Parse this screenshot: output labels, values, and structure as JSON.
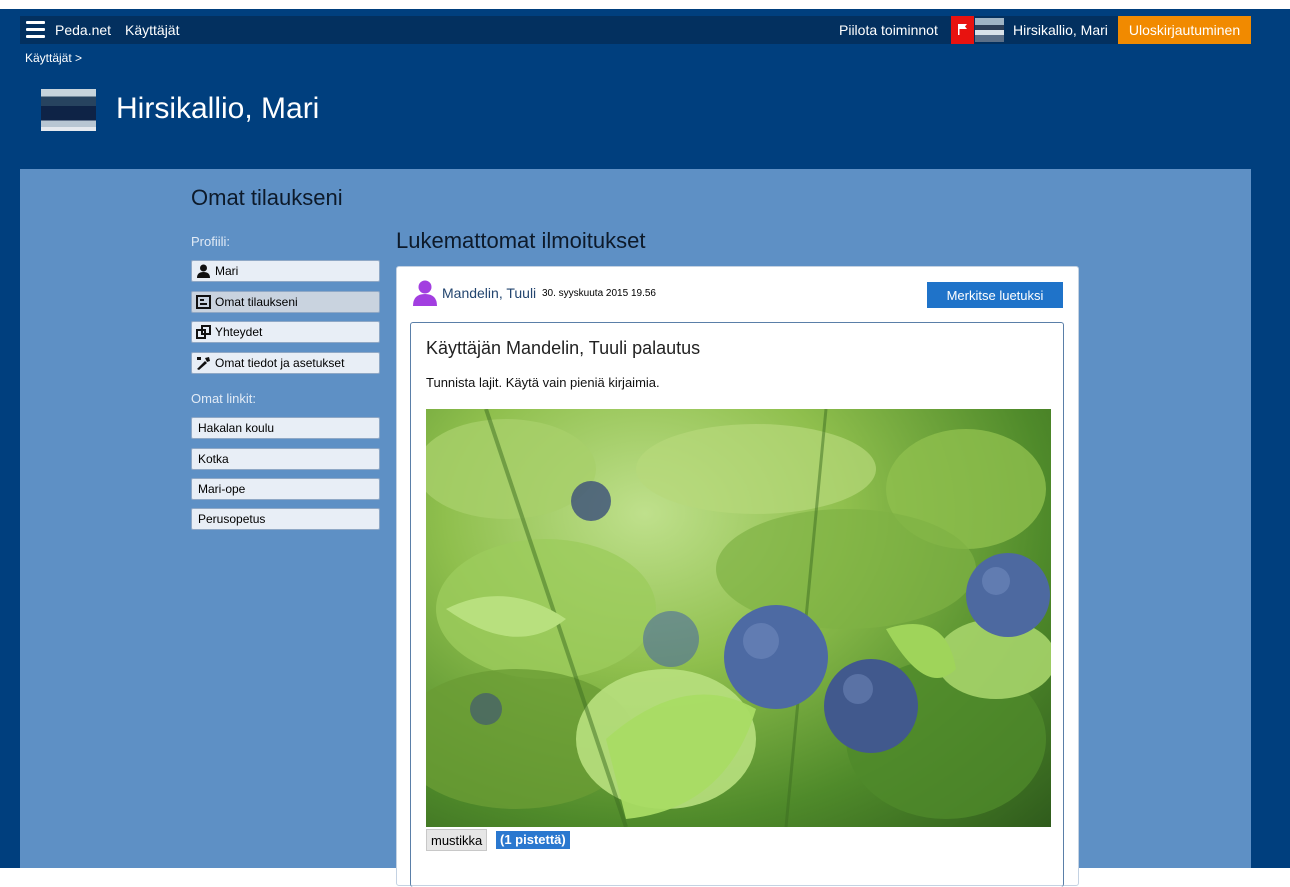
{
  "topbar": {
    "brand": "Peda.net",
    "users": "Käyttäjät",
    "hide_actions": "Piilota toiminnot",
    "user_name": "Hirsikallio, Mari",
    "logout": "Uloskirjautuminen"
  },
  "breadcrumb": "Käyttäjät >",
  "page_title": "Hirsikallio, Mari",
  "section_title": "Omat tilaukseni",
  "sidebar": {
    "profile_label": "Profiili:",
    "profile_items": [
      {
        "label": "Mari",
        "icon": "person-icon"
      },
      {
        "label": "Omat tilaukseni",
        "icon": "subscriptions-icon"
      },
      {
        "label": "Yhteydet",
        "icon": "connections-icon"
      },
      {
        "label": "Omat tiedot ja asetukset",
        "icon": "settings-tools-icon"
      }
    ],
    "links_label": "Omat linkit:",
    "links": [
      "Hakalan koulu",
      "Kotka",
      "Mari-ope",
      "Perusopetus"
    ]
  },
  "notifications": {
    "title": "Lukemattomat ilmoitukset",
    "item": {
      "author": "Mandelin, Tuuli",
      "date": "30. syyskuuta 2015 19.56",
      "mark_read": "Merkitse luetuksi",
      "content_title": "Käyttäjän Mandelin, Tuuli palautus",
      "instruction": "Tunnista lajit. Käytä vain pieniä kirjaimia.",
      "answer": "mustikka",
      "points": "(1 pistettä)"
    }
  },
  "colors": {
    "header_bg": "#003f7e",
    "content_bg": "#5e90c5",
    "flag": "#e8120f",
    "logout": "#f18a00",
    "button_blue": "#1f73c9",
    "user_icon": "#a23ee0"
  }
}
